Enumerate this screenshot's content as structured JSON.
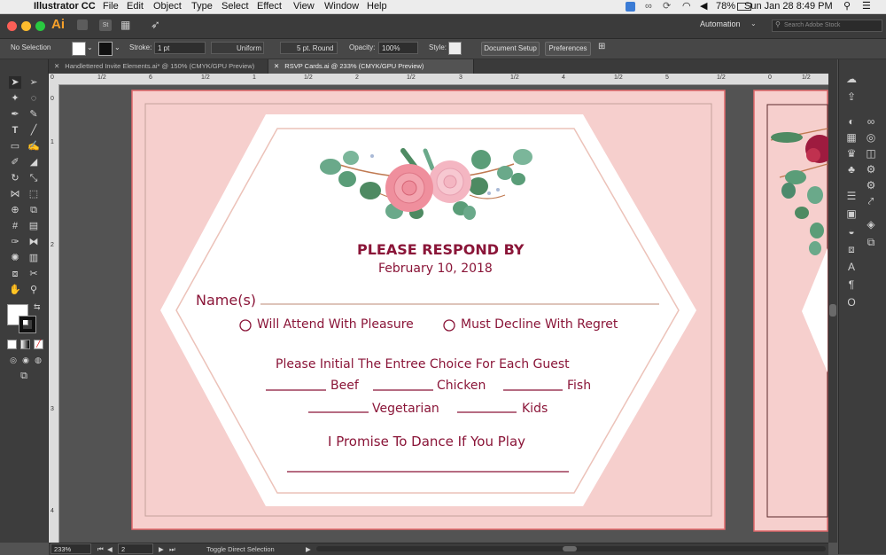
{
  "menubar": {
    "app": "Illustrator CC",
    "items": [
      "File",
      "Edit",
      "Object",
      "Type",
      "Select",
      "Effect",
      "View",
      "Window",
      "Help"
    ],
    "battery": "78%",
    "datetime": "Sun Jan 28  8:49 PM"
  },
  "appbar": {
    "logo": "Ai",
    "st": "St",
    "workspace": "Automation",
    "search_placeholder": "Search Adobe Stock"
  },
  "control": {
    "selection": "No Selection",
    "stroke_label": "Stroke:",
    "stroke_value": "1 pt",
    "stroke_style": "Uniform",
    "brush": "5 pt. Round",
    "opacity_label": "Opacity:",
    "opacity_value": "100%",
    "style_label": "Style:",
    "doc_setup": "Document Setup",
    "preferences": "Preferences"
  },
  "tabs": [
    {
      "label": "Handlettered Invite Elements.ai* @ 150% (CMYK/GPU Preview)"
    },
    {
      "label": "RSVP Cards.ai @ 233% (CMYK/GPU Preview)"
    }
  ],
  "hruler": [
    "0",
    "1/2",
    "6",
    "1/2",
    "1",
    "1/2",
    "2",
    "1/2",
    "3",
    "1/2",
    "4",
    "1/2",
    "5",
    "1/2",
    "0",
    "1/2"
  ],
  "vruler": [
    "0",
    "1",
    "2",
    "3",
    "4"
  ],
  "card": {
    "heading": "PLEASE RESPOND BY",
    "date": "February 10, 2018",
    "names_label": "Name(s)",
    "attend": "Will Attend With Pleasure",
    "decline": "Must Decline With Regret",
    "entree_heading": "Please Initial The Entree Choice For Each Guest",
    "beef": "Beef",
    "chicken": "Chicken",
    "fish": "Fish",
    "vegetarian": "Vegetarian",
    "kids": "Kids",
    "dance": "I Promise To Dance If You Play"
  },
  "status": {
    "zoom": "233%",
    "artboard": "2",
    "tool": "Toggle Direct Selection"
  },
  "colors": {
    "accent": "#8a1538",
    "card_bg": "#f6cfcd",
    "artboard_border": "#e0676a"
  }
}
